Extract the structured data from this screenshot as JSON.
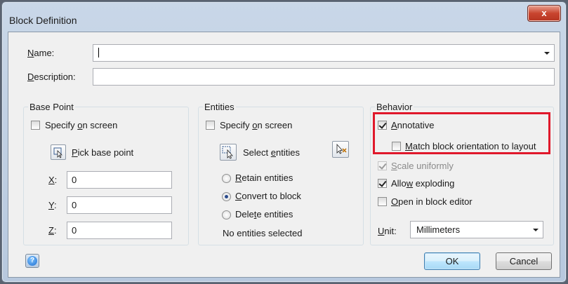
{
  "window": {
    "title": "Block Definition",
    "close_glyph": "x"
  },
  "name": {
    "label": "Name:",
    "value": ""
  },
  "description": {
    "label": "Description:",
    "value": ""
  },
  "base_point": {
    "title": "Base Point",
    "specify_on_screen": {
      "label": "Specify on screen",
      "checked": false
    },
    "pick_button": {
      "label": "Pick base point",
      "icon": "pick-point-icon"
    },
    "x": {
      "label": "X:",
      "value": "0"
    },
    "y": {
      "label": "Y:",
      "value": "0"
    },
    "z": {
      "label": "Z:",
      "value": "0"
    }
  },
  "entities": {
    "title": "Entities",
    "specify_on_screen": {
      "label": "Specify on screen",
      "checked": false
    },
    "select_button": {
      "label": "Select entities",
      "icon": "select-entities-icon"
    },
    "quick_select_icon": "quick-select-icon",
    "options": [
      {
        "label": "Retain entities",
        "selected": false
      },
      {
        "label": "Convert to block",
        "selected": true
      },
      {
        "label": "Delete entities",
        "selected": false
      }
    ],
    "status": "No entities selected"
  },
  "behavior": {
    "title": "Behavior",
    "annotative": {
      "label": "Annotative",
      "checked": true
    },
    "match_orientation": {
      "label": "Match block orientation to layout",
      "checked": false
    },
    "scale_uniformly": {
      "label": "Scale uniformly",
      "checked": true,
      "disabled": true
    },
    "allow_exploding": {
      "label": "Allow exploding",
      "checked": true
    },
    "open_in_editor": {
      "label": "Open in block editor",
      "checked": false
    },
    "unit": {
      "label": "Unit:",
      "value": "Millimeters"
    }
  },
  "footer": {
    "ok": "OK",
    "cancel": "Cancel",
    "help_icon": "help-icon"
  },
  "colors": {
    "highlight": "#e0182b",
    "titlebar": "#c9d7e8",
    "close_button": "#c9452f",
    "client": "#f0f0f0"
  }
}
